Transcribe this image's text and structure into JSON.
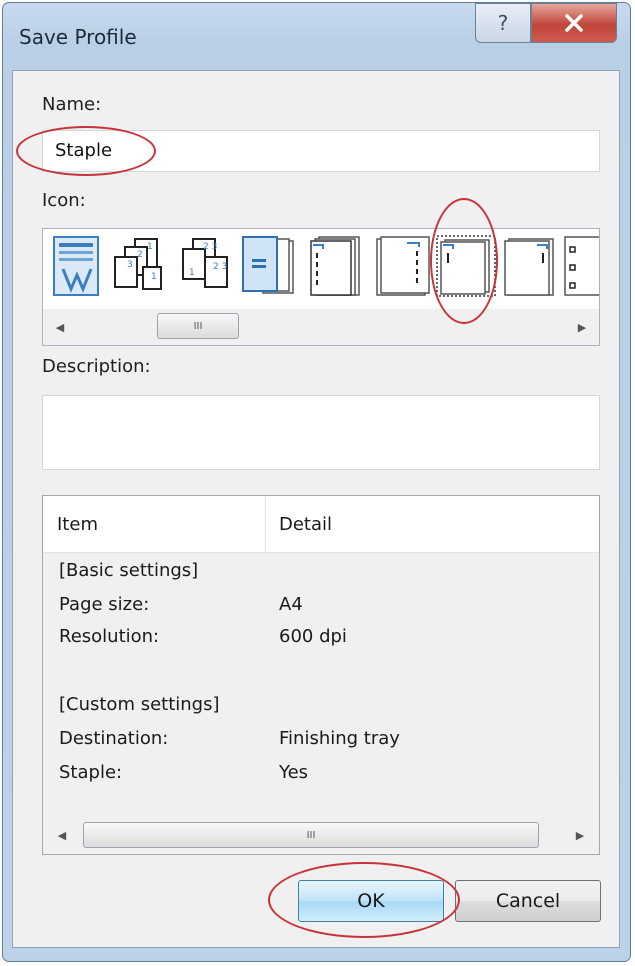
{
  "window": {
    "title": "Save Profile",
    "help_glyph": "?",
    "close_glyph": "✕"
  },
  "name_field": {
    "label": "Name:",
    "value": "Staple"
  },
  "icon_field": {
    "label": "Icon:",
    "icons": [
      "document-icon",
      "collate-stack-icon",
      "collate-stack-2-icon",
      "booklet-icon",
      "staple-left-icon",
      "staple-left-dashed-icon",
      "staple-top-left-icon",
      "staple-top-right-icon",
      "punch-holes-icon"
    ],
    "selected_index": 6,
    "scroll": {
      "left": "◀",
      "right": "▶",
      "grip": "III"
    }
  },
  "description_field": {
    "label": "Description:",
    "value": ""
  },
  "details": {
    "columns": [
      "Item",
      "Detail"
    ],
    "rows": [
      {
        "item": "[Basic settings]",
        "detail": ""
      },
      {
        "item": "Page size:",
        "detail": "A4"
      },
      {
        "item": "Resolution:",
        "detail": "600 dpi"
      },
      {
        "item": "",
        "detail": ""
      },
      {
        "item": "[Custom settings]",
        "detail": ""
      },
      {
        "item": "Destination:",
        "detail": "Finishing tray"
      },
      {
        "item": "Staple:",
        "detail": "Yes"
      }
    ],
    "scroll": {
      "left": "◀",
      "right": "▶",
      "grip": "III"
    }
  },
  "buttons": {
    "ok": "OK",
    "cancel": "Cancel"
  },
  "colors": {
    "annotation": "#c8333a",
    "accent": "#3c7fb1"
  }
}
